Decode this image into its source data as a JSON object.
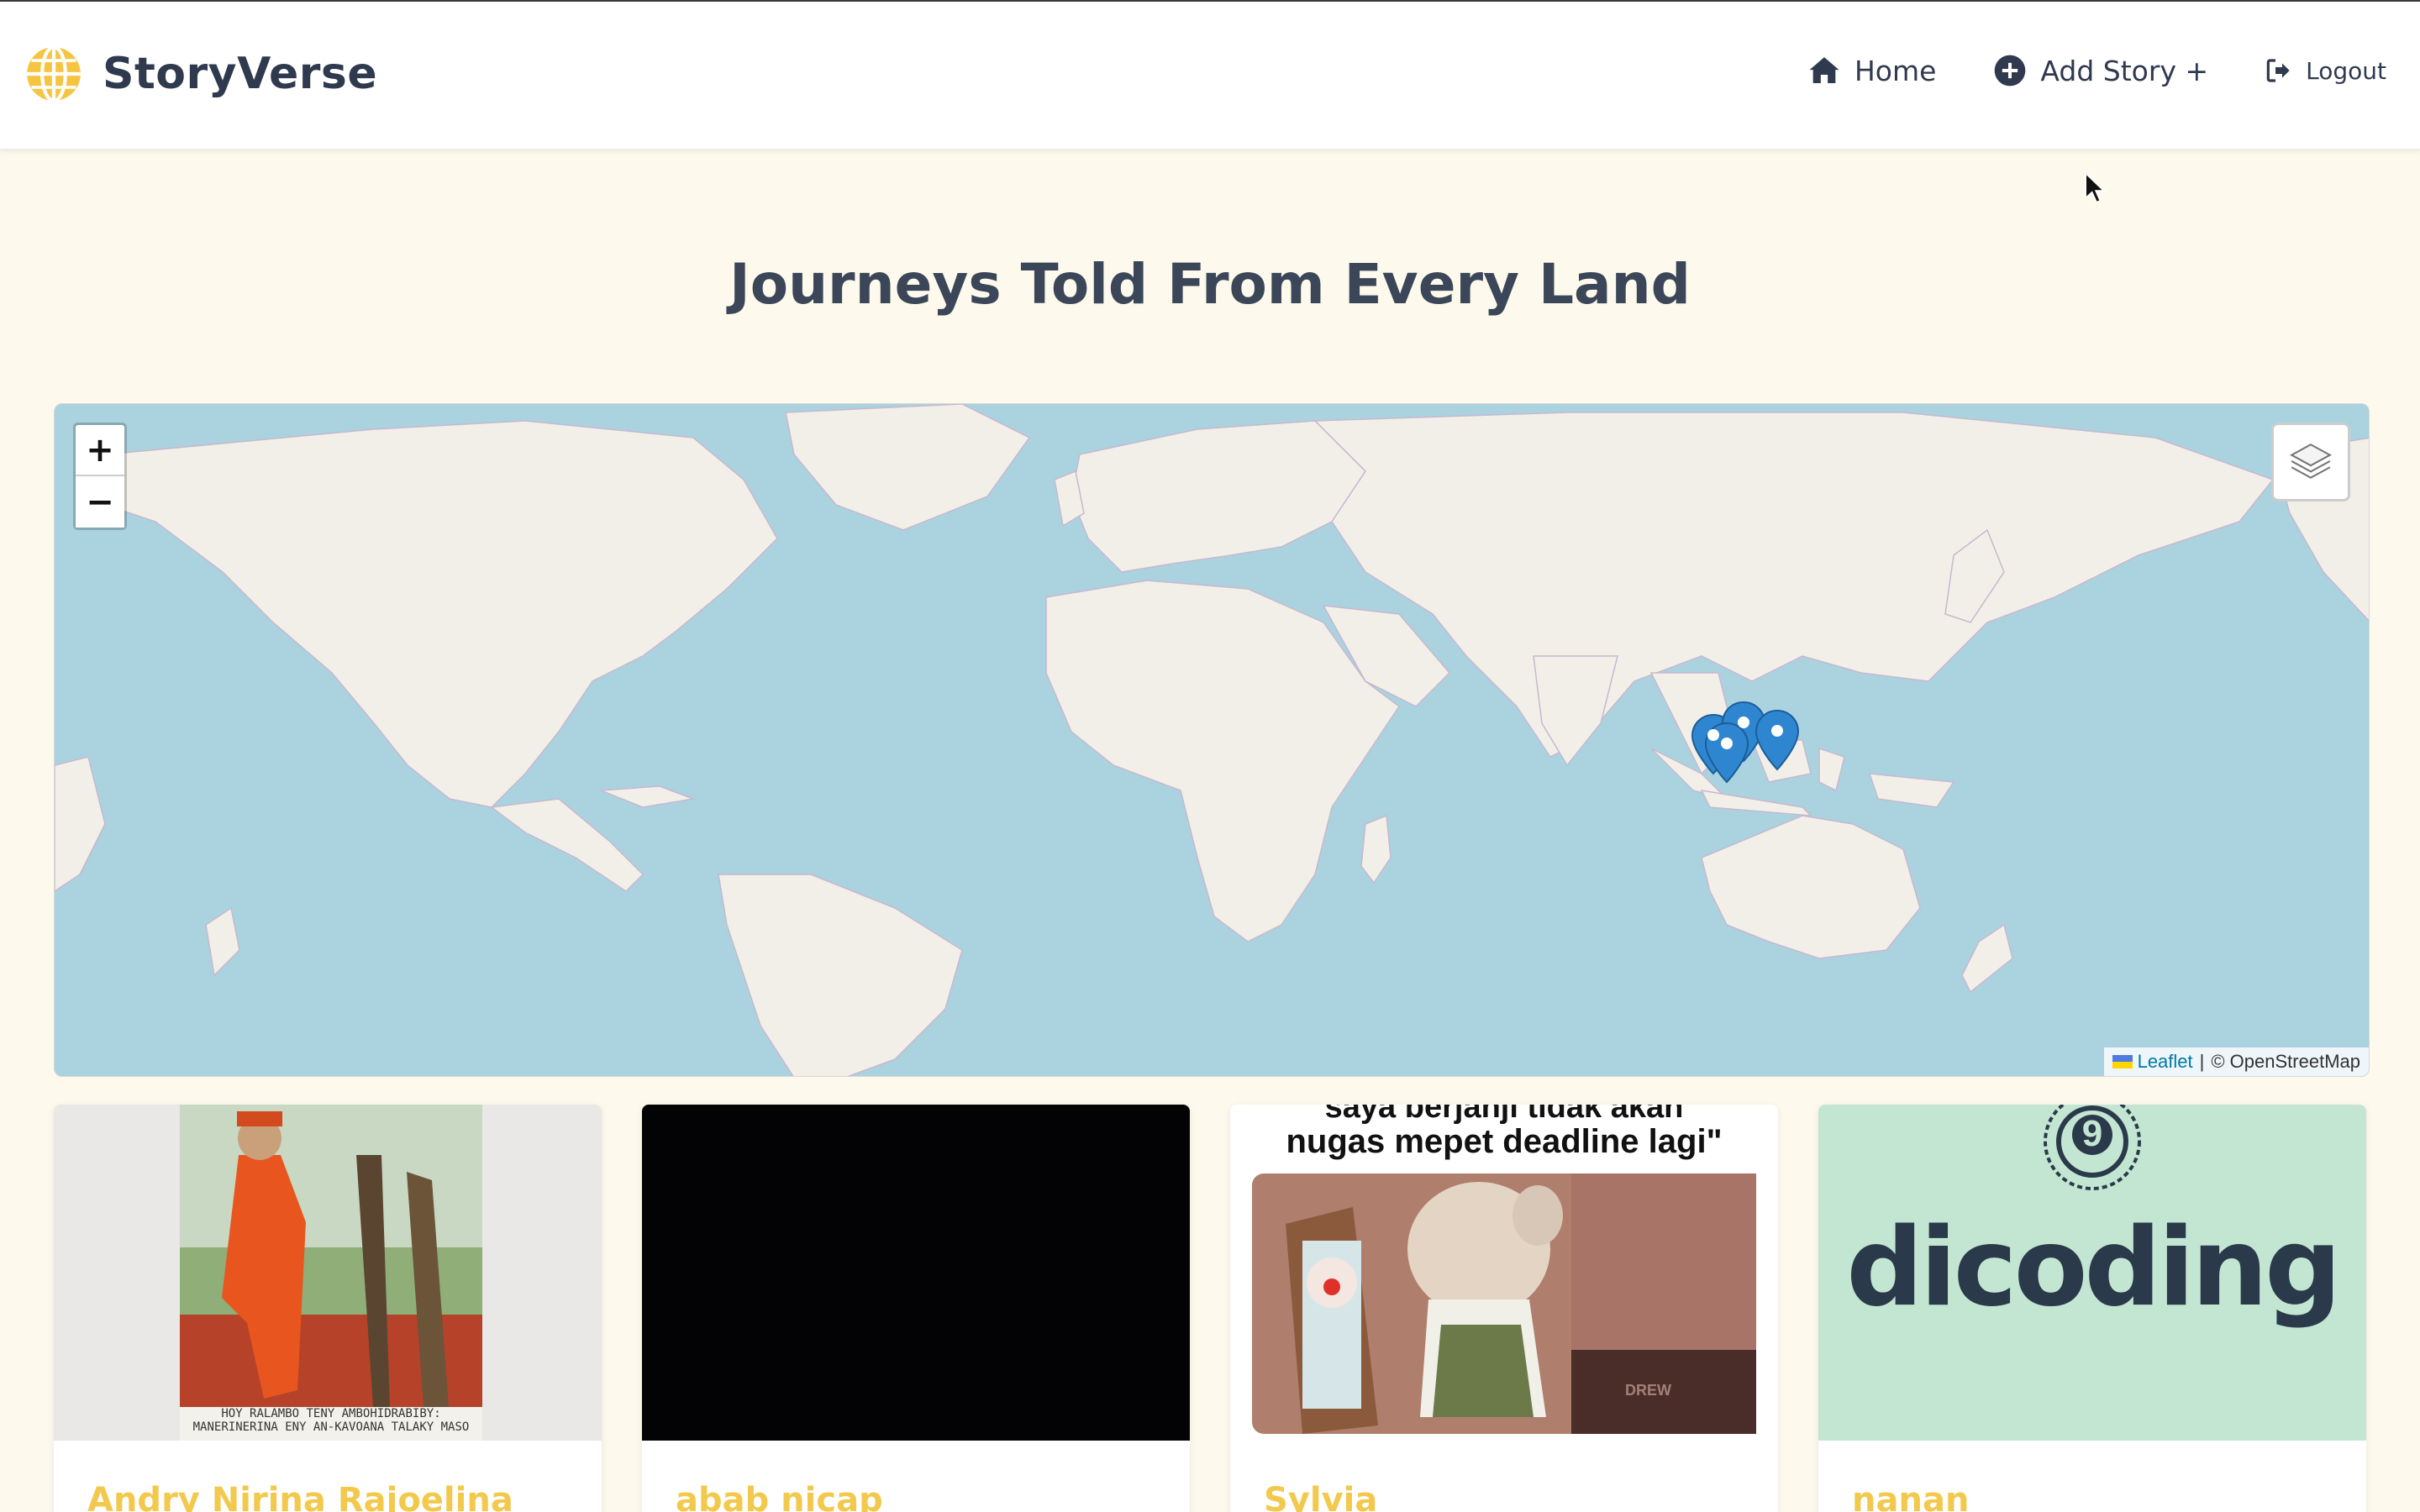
{
  "app": {
    "name": "StoryVerse",
    "logo_icon": "globe-icon",
    "accent_color": "#f5c542"
  },
  "nav": {
    "items": [
      {
        "label": "Home",
        "icon": "home-icon"
      },
      {
        "label": "Add Story +",
        "icon": "plus-circle-icon"
      },
      {
        "label": "Logout",
        "icon": "logout-icon"
      }
    ]
  },
  "page": {
    "title": "Journeys Told From Every Land"
  },
  "map": {
    "zoom_in": "+",
    "zoom_out": "−",
    "attribution_leaflet": "Leaflet",
    "attribution_sep": "|",
    "attribution_osm": "© OpenStreetMap",
    "marker_count": 4
  },
  "stories": [
    {
      "name": "Andry Nirina Rajoelina",
      "image_desc": "painting",
      "image_caption": "HOY RALAMBO TENY AMBOHIDRABIBY: MANERINERINA ENY AN-KAVOANA TALAKY MASO"
    },
    {
      "name": "abab nicap",
      "image_desc": "black"
    },
    {
      "name": "Sylvia",
      "image_caption_top": "saya berjanji tidak akan",
      "image_caption_main": "nugas mepet deadline lagi\"",
      "watermark": "DREW"
    },
    {
      "name": "nanan",
      "image_logo_text": "dicoding",
      "image_badge": "9"
    }
  ]
}
